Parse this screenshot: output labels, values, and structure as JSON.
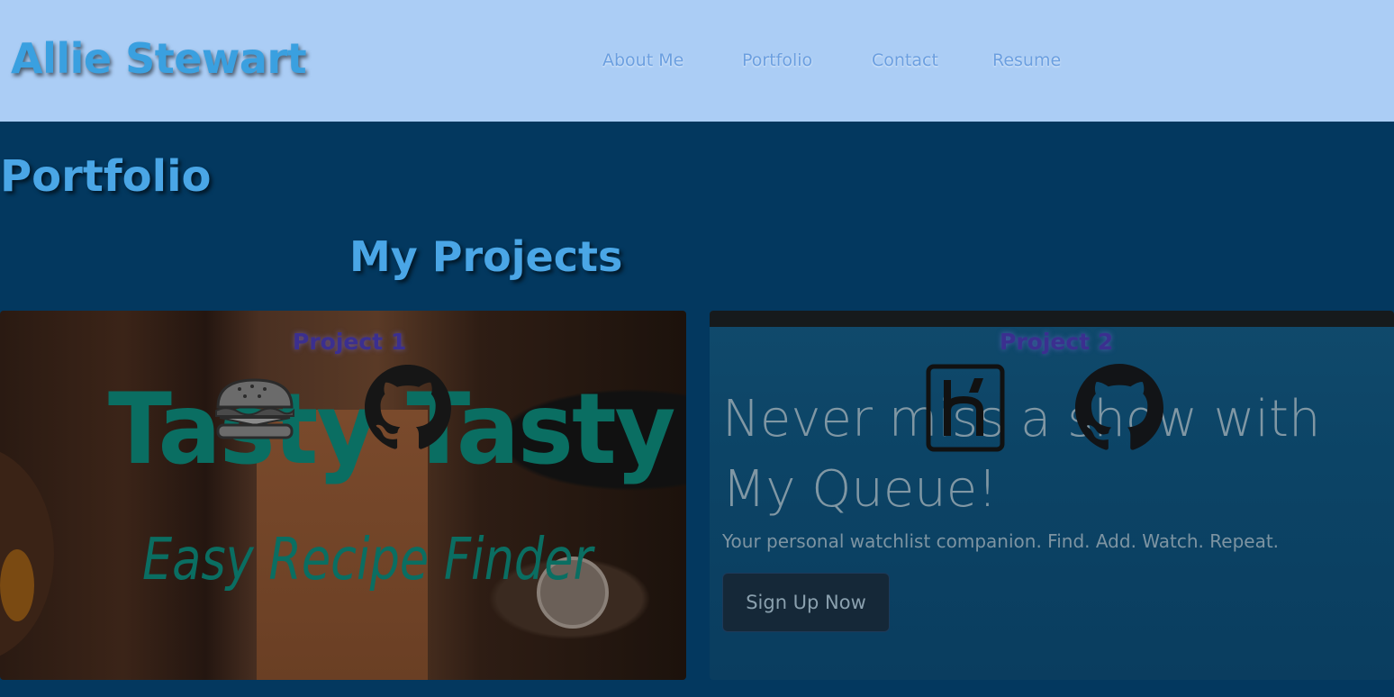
{
  "header": {
    "brand": "Allie Stewart",
    "nav": [
      "About Me",
      "Portfolio",
      "Contact",
      "Resume"
    ]
  },
  "page": {
    "title": "Portfolio",
    "section_title": "My Projects"
  },
  "projects": [
    {
      "label": "Project 1",
      "image_title": "Tasty Tasty",
      "image_subtitle": "Easy Recipe Finder",
      "icons": [
        "burger-icon",
        "github-icon"
      ]
    },
    {
      "label": "Project 2",
      "image_title": "Never miss a show with My Queue!",
      "image_subtitle": "Your personal watchlist companion. Find. Add. Watch. Repeat.",
      "image_button": "Sign Up Now",
      "icons": [
        "heroku-icon",
        "github-icon"
      ]
    }
  ],
  "colors": {
    "header_bg": "#abcdf5",
    "page_bg": "#03385f",
    "accent": "#4aa6e6"
  }
}
